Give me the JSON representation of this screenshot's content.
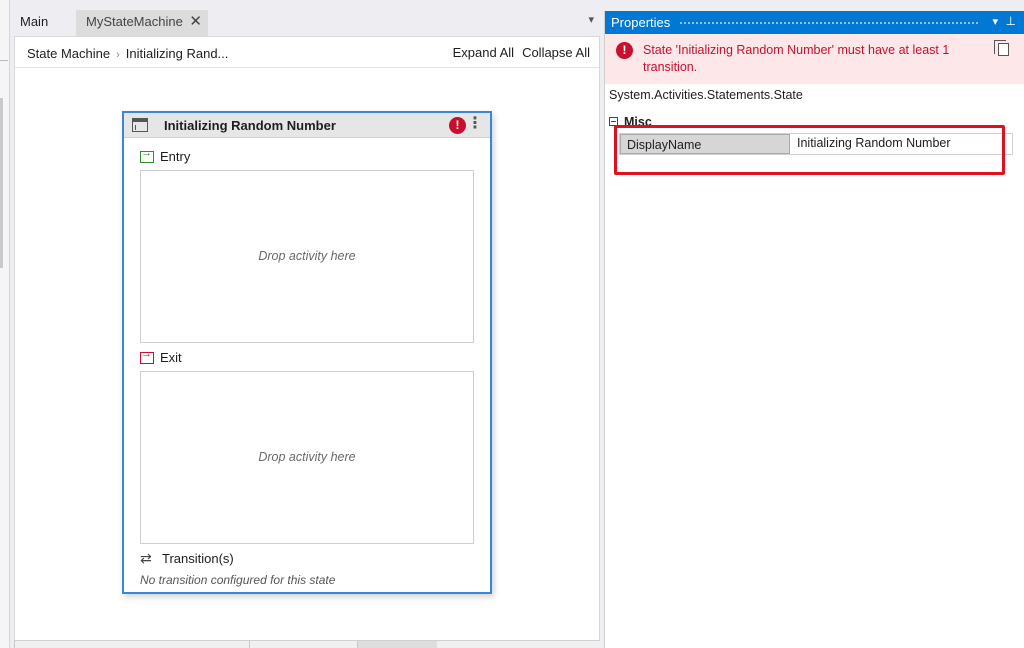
{
  "tabs": [
    {
      "label": "Main"
    },
    {
      "label": "MyStateMachine"
    }
  ],
  "breadcrumb": {
    "root": "State Machine",
    "current": "Initializing Rand..."
  },
  "header_actions": {
    "expand_all": "Expand All",
    "collapse_all": "Collapse All"
  },
  "state": {
    "name": "Initializing Random Number",
    "error_badge": "!",
    "entry_label": "Entry",
    "exit_label": "Exit",
    "transitions_label": "Transition(s)",
    "drop_placeholder": "Drop activity here",
    "no_transition": "No transition configured for this state"
  },
  "properties": {
    "title": "Properties",
    "error_message": "State 'Initializing Random Number' must have at least 1 transition.",
    "type_name": "System.Activities.Statements.State",
    "category": "Misc",
    "rows": [
      {
        "name": "DisplayName",
        "value": "Initializing Random Number"
      }
    ]
  },
  "colors": {
    "accent": "#0078d4",
    "error": "#c8102e",
    "highlight": "#e0101c",
    "selection_border": "#3b86d6"
  },
  "icons": [
    "close-icon",
    "chevron-down-icon",
    "chevron-right-icon",
    "state-icon",
    "error-icon",
    "more-icon",
    "entry-icon",
    "exit-icon",
    "transition-icon",
    "pin-icon",
    "copy-icon",
    "collapse-icon"
  ]
}
